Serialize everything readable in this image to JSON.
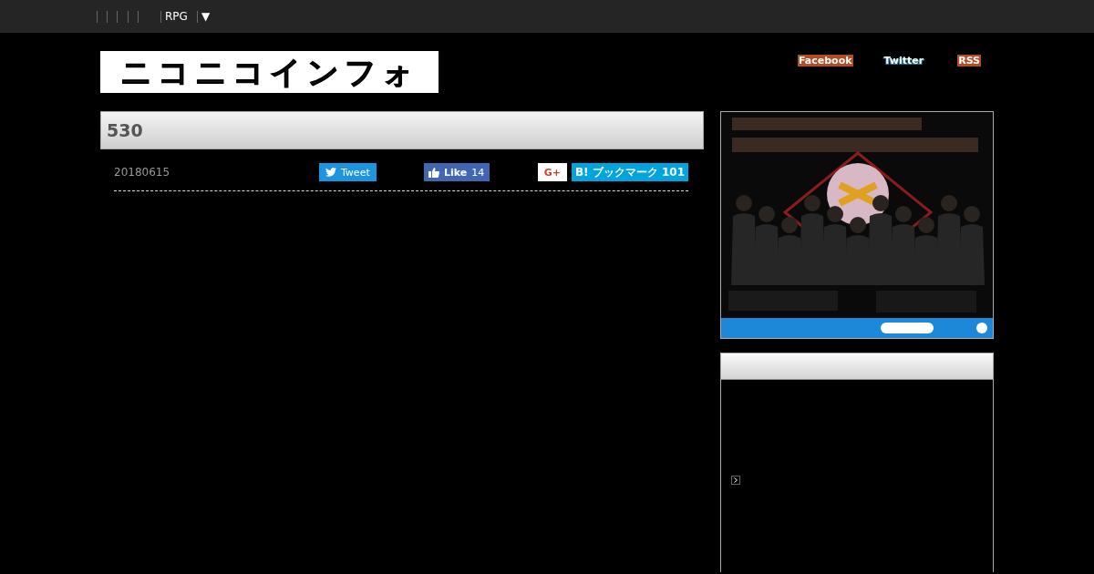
{
  "nav": {
    "items": [
      {
        "label": "RPG"
      },
      {
        "label": "▼"
      }
    ]
  },
  "logo": {
    "text": "ニコニコインフォ"
  },
  "social_links": [
    {
      "label": "Facebook",
      "kind": "facebook"
    },
    {
      "label": "Twitter",
      "kind": "twitter"
    },
    {
      "label": "RSS",
      "kind": "rss"
    }
  ],
  "article": {
    "title": "530",
    "date": "20180615",
    "share_buttons": [
      {
        "kind": "tweet",
        "label": "Tweet"
      },
      {
        "kind": "like",
        "label": "Like",
        "count": "14"
      },
      {
        "kind": "gplus",
        "label": "G+"
      },
      {
        "kind": "hatena",
        "label": "B! ブックマーク",
        "count": "101"
      }
    ]
  }
}
